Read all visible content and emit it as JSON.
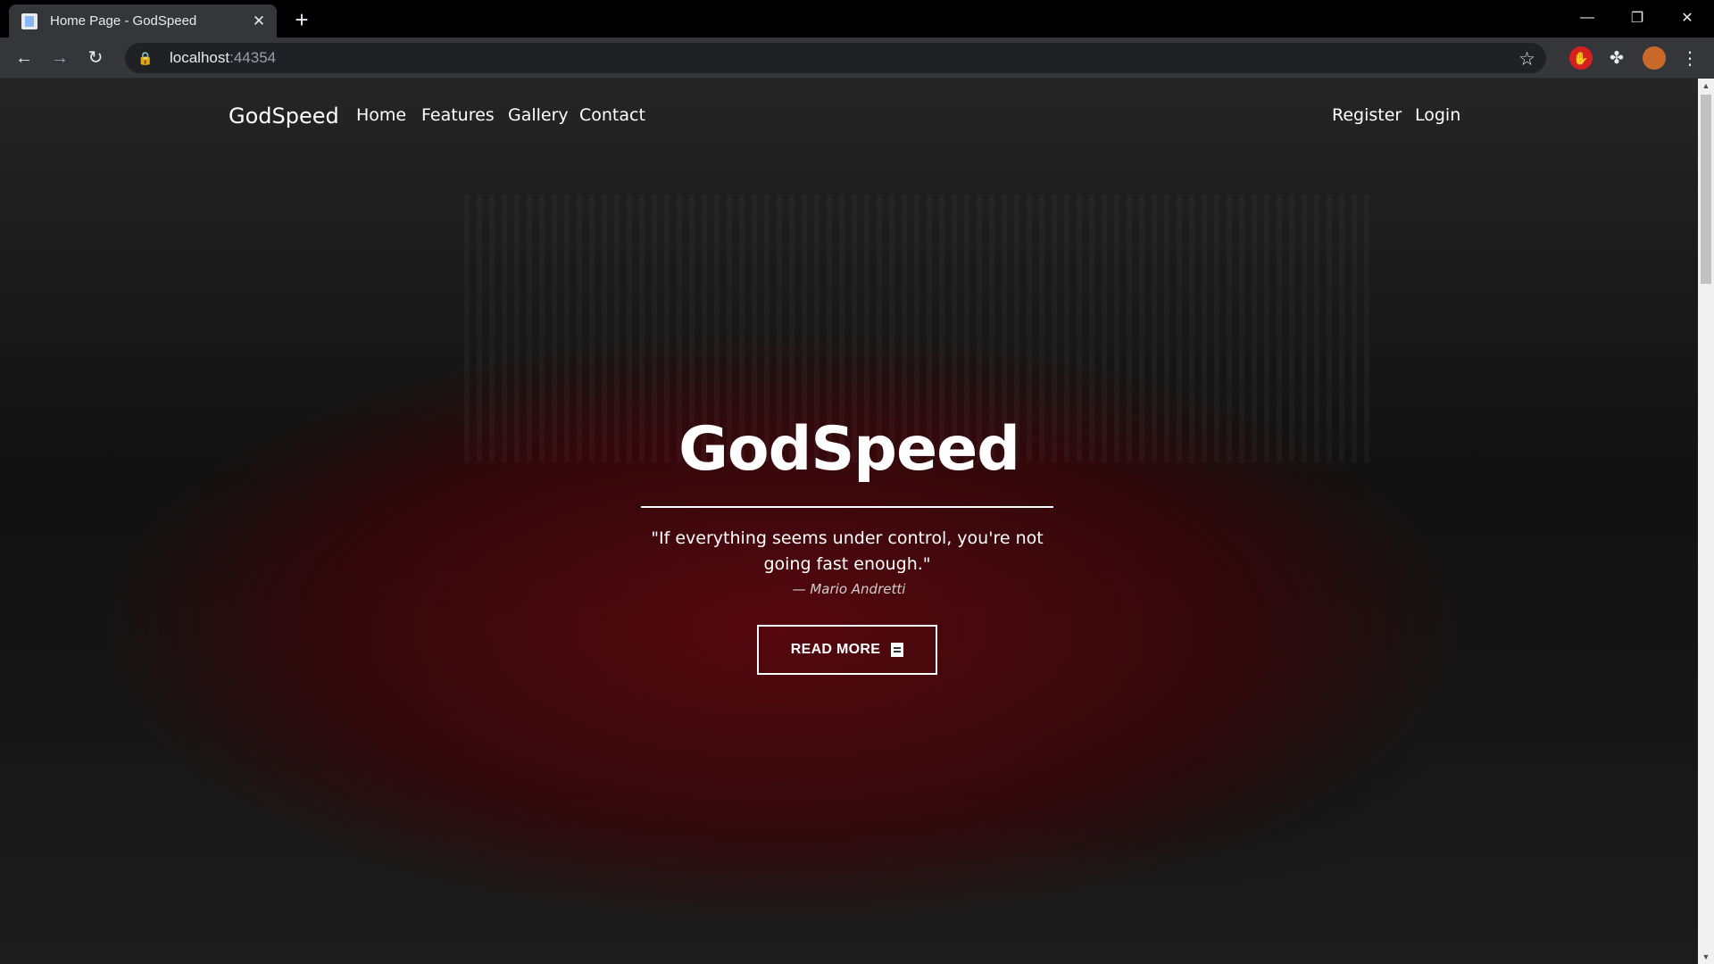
{
  "browser": {
    "tab_title": "Home Page - GodSpeed",
    "url_host": "localhost",
    "url_port": ":44354",
    "window_controls": [
      "minimize",
      "restore",
      "close"
    ]
  },
  "nav": {
    "brand": "GodSpeed",
    "links": [
      "Home",
      "Features",
      "Gallery",
      "Contact"
    ],
    "register": "Register",
    "login": "Login"
  },
  "hero": {
    "title": "GodSpeed",
    "quote": "\"If everything seems under control, you're not going fast enough.\"",
    "author": "— Mario Andretti",
    "button": "READ MORE"
  },
  "icons": {
    "favicon": "page-icon",
    "new_tab": "plus-icon",
    "back": "arrow-left-icon",
    "forward": "arrow-right-icon",
    "reload": "reload-icon",
    "lock": "lock-icon",
    "bookmark": "star-icon",
    "extensions": "puzzle-icon",
    "menu": "kebab-menu-icon",
    "button_icon": "book-icon"
  }
}
